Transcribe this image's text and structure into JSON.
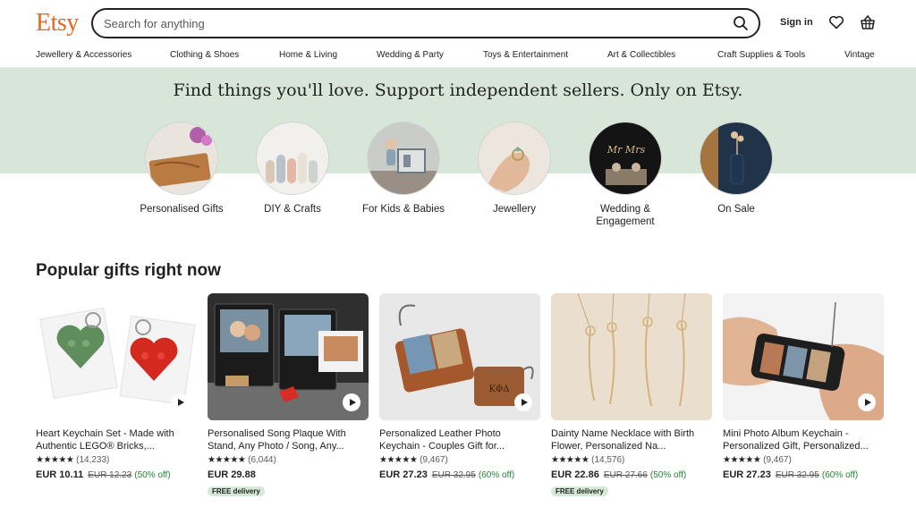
{
  "brand": {
    "logo": "Etsy",
    "color": "#f1641e"
  },
  "search": {
    "placeholder": "Search for anything",
    "value": "",
    "icon": "search-icon"
  },
  "header": {
    "sign_in": "Sign in",
    "favorites_icon": "heart-icon",
    "basket_icon": "basket-icon"
  },
  "nav": {
    "items": [
      "Jewellery & Accessories",
      "Clothing & Shoes",
      "Home & Living",
      "Wedding & Party",
      "Toys & Entertainment",
      "Art & Collectibles",
      "Craft Supplies & Tools",
      "Vintage"
    ]
  },
  "hero": {
    "tagline": "Find things you'll love. Support independent sellers. Only on Etsy.",
    "background": "#d7e6d8",
    "categories": [
      {
        "label": "Personalised Gifts"
      },
      {
        "label": "DIY & Crafts"
      },
      {
        "label": "For Kids & Babies"
      },
      {
        "label": "Jewellery"
      },
      {
        "label": "Wedding & Engagement"
      },
      {
        "label": "On Sale"
      }
    ]
  },
  "popular": {
    "title": "Popular gifts right now",
    "items": [
      {
        "title": "Heart Keychain Set - Made with Authentic LEGO® Bricks,...",
        "stars": "★★★★★",
        "reviews": "(14,233)",
        "price": "EUR 10.11",
        "original_price": "EUR 12.23",
        "discount": "(50% off)",
        "badge": ""
      },
      {
        "title": "Personalised Song Plaque With Stand, Any Photo / Song, Any...",
        "stars": "★★★★★",
        "reviews": "(6,044)",
        "price": "EUR 29.88",
        "original_price": "",
        "discount": "",
        "badge": "FREE delivery"
      },
      {
        "title": "Personalized Leather Photo Keychain - Couples Gift for...",
        "stars": "★★★★★",
        "reviews": "(9,467)",
        "price": "EUR 27.23",
        "original_price": "EUR 32.95",
        "discount": "(60% off)",
        "badge": ""
      },
      {
        "title": "Dainty Name Necklace with Birth Flower, Personalized Na...",
        "stars": "★★★★★",
        "reviews": "(14,576)",
        "price": "EUR 22.86",
        "original_price": "EUR 27.66",
        "discount": "(50% off)",
        "badge": "FREE delivery"
      },
      {
        "title": "Mini Photo Album Keychain - Personalized Gift, Personalized...",
        "stars": "★★★★★",
        "reviews": "(9,467)",
        "price": "EUR 27.23",
        "original_price": "EUR 32.95",
        "discount": "(60% off)",
        "badge": ""
      }
    ]
  }
}
